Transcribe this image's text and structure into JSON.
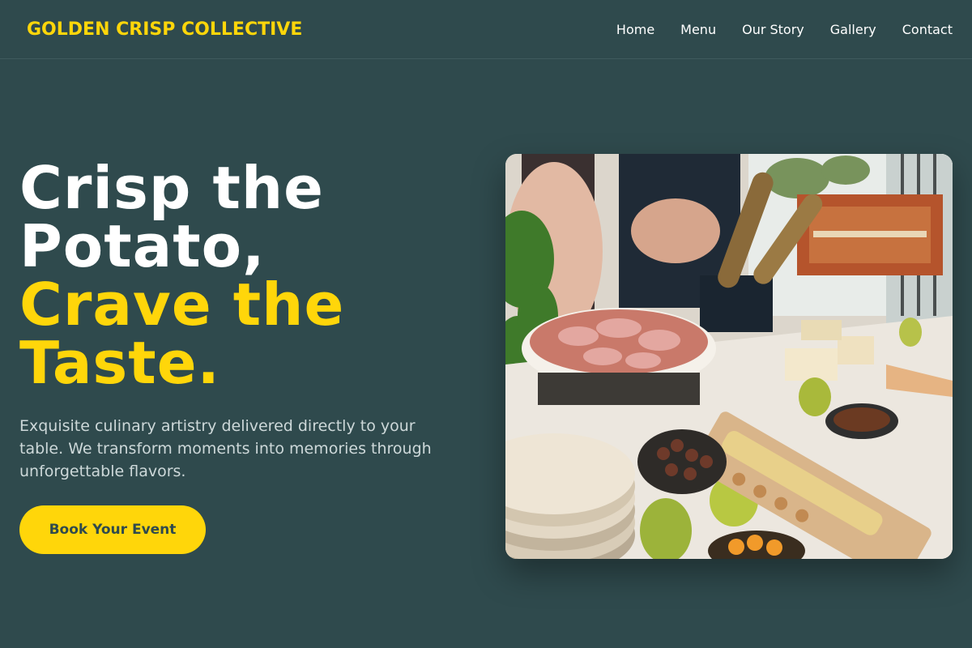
{
  "header": {
    "brand": "GOLDEN CRISP COLLECTIVE",
    "nav": [
      "Home",
      "Menu",
      "Our Story",
      "Gallery",
      "Contact"
    ]
  },
  "hero": {
    "headline_white_1": "Crisp the",
    "headline_white_2": "Potato,",
    "headline_yellow_1": "Crave the",
    "headline_yellow_2": "Taste.",
    "subtext": "Exquisite culinary artistry delivered directly to your table. We transform moments into memories through unforgettable flavors.",
    "cta_label": "Book Your Event"
  },
  "image": {
    "subject": "catering grazing table with charcuterie, cheeses, pears, bread and crackers"
  },
  "colors": {
    "background": "#2f4a4d",
    "accent": "#ffd60a",
    "text": "#ffffff",
    "muted_text": "#cdd8d9"
  }
}
